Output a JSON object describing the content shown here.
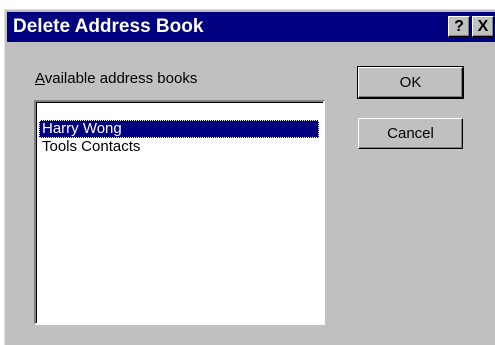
{
  "window": {
    "title": "Delete Address Book",
    "help_glyph": "?",
    "close_glyph": "X"
  },
  "label": {
    "accelerator": "A",
    "rest": "vailable address books"
  },
  "list": {
    "items": [
      "Harry Wong",
      "Tools Contacts"
    ],
    "selected_index": 0
  },
  "buttons": {
    "ok": "OK",
    "cancel": "Cancel"
  },
  "colors": {
    "titlebar": "#000080",
    "dialog_face": "#c0c0c0",
    "selection": "#000080"
  }
}
